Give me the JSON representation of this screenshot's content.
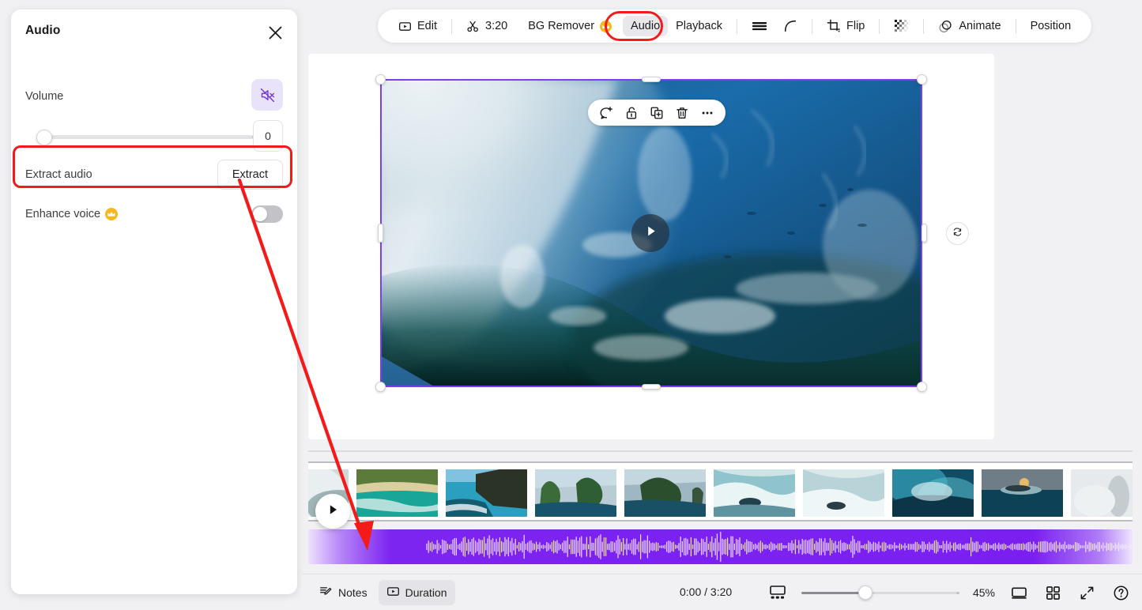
{
  "panel": {
    "title": "Audio",
    "close_icon": "close-icon",
    "volume": {
      "label": "Volume",
      "value": "0",
      "mute_icon": "mute-speaker-icon",
      "muted": true
    },
    "extract": {
      "label": "Extract audio",
      "button": "Extract"
    },
    "enhance": {
      "label": "Enhance voice",
      "badge_icon": "crown-icon",
      "enabled": false
    }
  },
  "toolbar": {
    "items": [
      {
        "label": "Edit",
        "icon": "video-play-box-icon",
        "active": false
      },
      {
        "label": "3:20",
        "icon": "scissors-icon",
        "active": false
      },
      {
        "label": "BG Remover",
        "icon": "",
        "badge": "crown-icon",
        "active": false
      },
      {
        "label": "Audio",
        "icon": "",
        "active": true
      },
      {
        "label": "Playback",
        "icon": "",
        "active": false
      },
      {
        "label": "",
        "icon": "opacity-lines-icon",
        "active": false
      },
      {
        "label": "",
        "icon": "corner-radius-icon",
        "active": false
      },
      {
        "label": "Flip",
        "icon": "crop-icon",
        "active": false
      },
      {
        "label": "",
        "icon": "transparency-checker-icon",
        "active": false
      },
      {
        "label": "Animate",
        "icon": "animate-circles-icon",
        "active": false
      },
      {
        "label": "Position",
        "icon": "",
        "active": false
      }
    ]
  },
  "canvas": {
    "float_toolbar": [
      {
        "icon": "comment-add-icon"
      },
      {
        "icon": "unlock-icon"
      },
      {
        "icon": "duplicate-icon"
      },
      {
        "icon": "trash-icon"
      },
      {
        "icon": "more-options-icon"
      }
    ],
    "play_icon": "play-triangle-icon",
    "rotate_icon": "rotate-icon",
    "selection_color": "#7b3ff2"
  },
  "timeline": {
    "play_icon": "play-triangle-icon",
    "thumbnail_count": 11,
    "audio_track_color": "#7a1ff0"
  },
  "bottom_bar": {
    "notes": {
      "label": "Notes",
      "icon": "notes-icon"
    },
    "duration": {
      "label": "Duration",
      "icon": "video-play-box-icon",
      "active": true
    },
    "time": "0:00 / 3:20",
    "zoom_percent": "45%",
    "icons": [
      "timeline-view-icon",
      "fit-screen-icon",
      "grid-view-icon",
      "fullscreen-icon",
      "help-icon"
    ]
  },
  "annotations": {
    "highlight_color": "#f51a1a",
    "boxes": [
      {
        "name": "audio-tab-highlight"
      },
      {
        "name": "extract-audio-row-highlight"
      }
    ],
    "arrow": {
      "name": "extract-to-audio-track-arrow"
    }
  }
}
